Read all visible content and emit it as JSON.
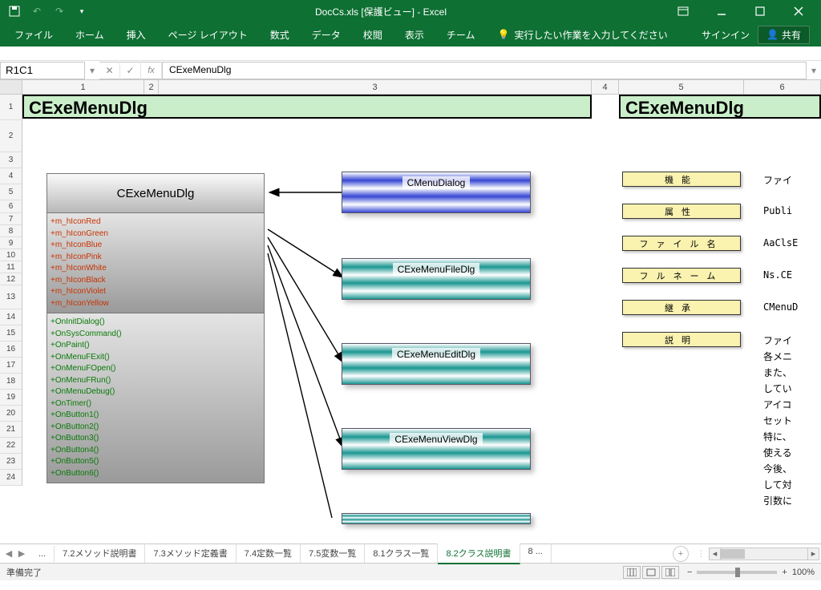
{
  "titlebar": {
    "title": "DocCs.xls [保護ビュー] - Excel"
  },
  "ribbon": {
    "tabs": [
      "ファイル",
      "ホーム",
      "挿入",
      "ページ レイアウト",
      "数式",
      "データ",
      "校閲",
      "表示",
      "チーム"
    ],
    "tellme": "実行したい作業を入力してください",
    "signin": "サインイン",
    "share": "共有"
  },
  "formulabar": {
    "namebox": "R1C1",
    "formula": "CExeMenuDlg"
  },
  "colheaders": [
    "1",
    "2",
    "3",
    "4",
    "5",
    "6"
  ],
  "rowheaders": [
    "1",
    "2",
    "3",
    "4",
    "5",
    "6",
    "7",
    "8",
    "9",
    "10",
    "11",
    "12",
    "13",
    "14",
    "15",
    "16",
    "17",
    "18",
    "19",
    "20",
    "21",
    "22",
    "23",
    "24"
  ],
  "titleCells": {
    "left": "CExeMenuDlg",
    "right": "CExeMenuDlg"
  },
  "classbox": {
    "title": "CExeMenuDlg",
    "members": [
      "+m_hIconRed",
      "+m_hIconGreen",
      "+m_hIconBlue",
      "+m_hIconPink",
      "+m_hIconWhite",
      "+m_hIconBlack",
      "+m_hIconViolet",
      "+m_hIconYellow"
    ],
    "methods": [
      "+OnInitDialog()",
      "+OnSysCommand()",
      "+OnPaint()",
      "+OnMenuFExit()",
      "+OnMenuFOpen()",
      "+OnMenuFRun()",
      "+OnMenuDebug()",
      "+OnTimer()",
      "+OnButton1()",
      "+OnButton2()",
      "+OnButton3()",
      "+OnButton4()",
      "+OnButton5()",
      "+OnButton6()"
    ]
  },
  "relboxes": [
    "CMenuDialog",
    "CExeMenuFileDlg",
    "CExeMenuEditDlg",
    "CExeMenuViewDlg"
  ],
  "ylabels": [
    "機能",
    "属性",
    "ファイル名",
    "フルネーム",
    "継承",
    "説明"
  ],
  "rtexts": [
    "ファイ",
    "Publi",
    "AaClsE",
    "Ns.CE",
    "CMenuD",
    "ファイ",
    "各メニ",
    "また、",
    "してい",
    "アイコ",
    "セット",
    "特に、",
    "使える",
    "今後、",
    "して対",
    "引数に"
  ],
  "sheettabs": {
    "ellipsis_left": "...",
    "tabs": [
      "7.2メソッド説明書",
      "7.3メソッド定義書",
      "7.4定数一覧",
      "7.5変数一覧",
      "8.1クラス一覧",
      "8.2クラス説明書"
    ],
    "activeIndex": 5,
    "ellipsis_right": "8 ..."
  },
  "statusbar": {
    "ready": "準備完了",
    "zoom": "100%"
  }
}
